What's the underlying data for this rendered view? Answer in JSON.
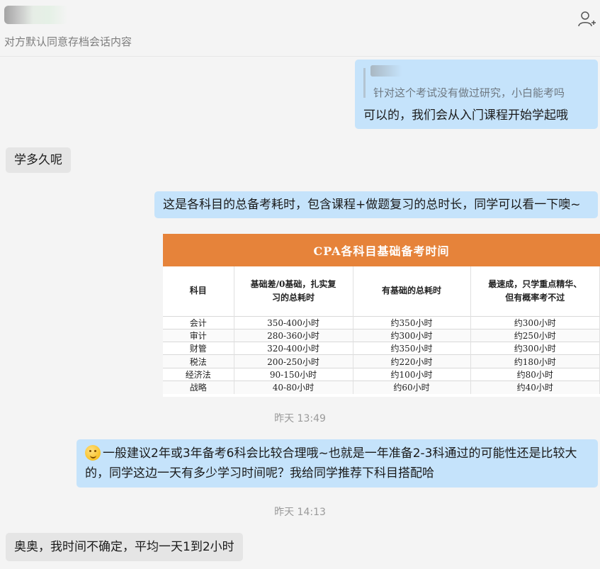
{
  "header": {
    "subtitle": "对方默认同意存档会话内容",
    "add_member_icon": "add-person-icon"
  },
  "messages": {
    "quote": {
      "quoted_text": "针对这个考试没有做过研究，小白能考吗",
      "reply": "可以的，我们会从入门课程开始学起哦"
    },
    "m1": "学多久呢",
    "m2": "这是各科目的总备考耗时，包含课程+做题复习的总时长，同学可以看一下噢~",
    "m3_line1": "一般建议2年或3年备考6科会比较合理哦~也就是一年准备2-3科通过的可能性还是比较大",
    "m3_line2": "的，同学这边一天有多少学习时间呢？我给同学推荐下科目搭配哈",
    "m4": "奥奥，我时间不确定，平均一天1到2小时"
  },
  "timestamps": {
    "t1": "昨天 13:49",
    "t2": "昨天 14:13"
  },
  "table": {
    "title": "CPA各科目基础备考时间",
    "headers": {
      "h1": "科目",
      "h2_line1": "基础差/0基础，扎实复",
      "h2_line2": "习的总耗时",
      "h3": "有基础的总耗时",
      "h4_line1": "最速成，只学重点精华、",
      "h4_line2": "但有概率考不过"
    },
    "rows": [
      [
        "会计",
        "350-400小时",
        "约350小时",
        "约300小时"
      ],
      [
        "审计",
        "280-360小时",
        "约300小时",
        "约250小时"
      ],
      [
        "财管",
        "320-400小时",
        "约350小时",
        "约300小时"
      ],
      [
        "税法",
        "200-250小时",
        "约220小时",
        "约180小时"
      ],
      [
        "经济法",
        "90-150小时",
        "约100小时",
        "约80小时"
      ],
      [
        "战略",
        "40-80小时",
        "约60小时",
        "约40小时"
      ]
    ]
  },
  "colors": {
    "outgoing_bubble": "#c5e3fb",
    "incoming_bubble": "#e5e5e5",
    "table_header": "#e6833a"
  }
}
